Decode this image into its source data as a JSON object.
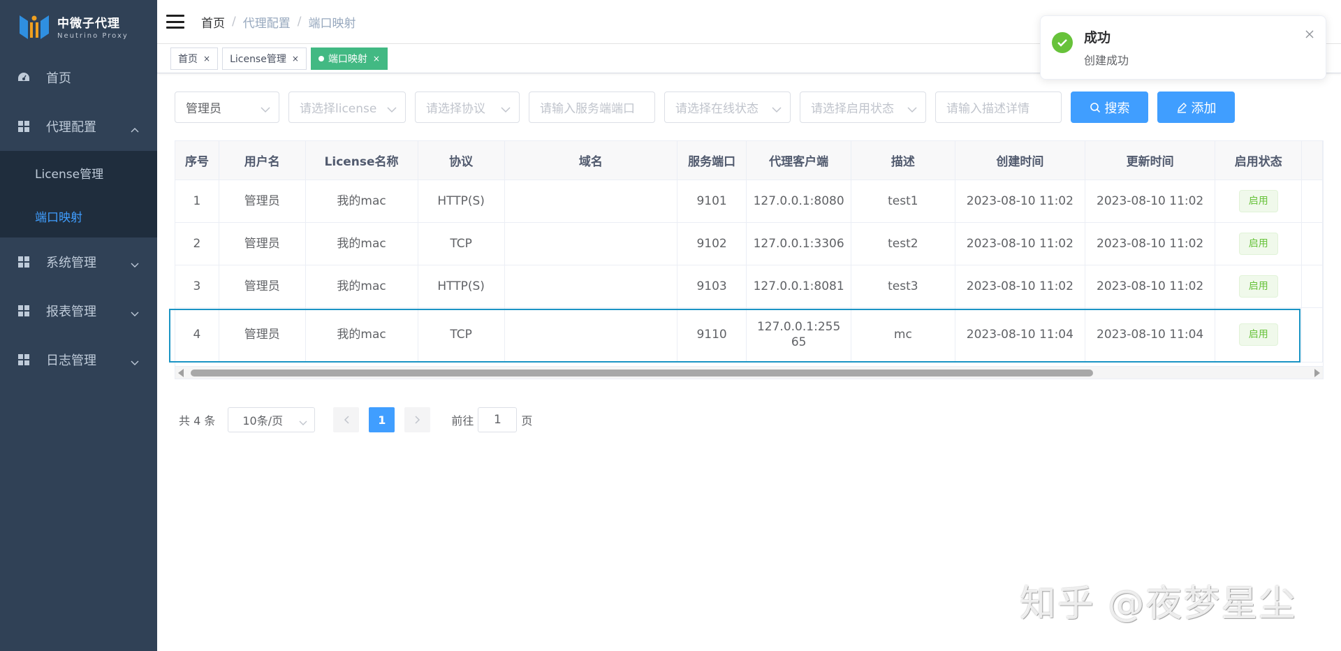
{
  "app": {
    "logo_title": "中微子代理",
    "logo_subtitle": "Neutrino Proxy"
  },
  "sidebar": {
    "items": [
      {
        "label": "首页",
        "icon": "dashboard-icon"
      },
      {
        "label": "代理配置",
        "icon": "grid-icon",
        "expanded": true,
        "children": [
          {
            "label": "License管理",
            "active": false
          },
          {
            "label": "端口映射",
            "active": true
          }
        ]
      },
      {
        "label": "系统管理",
        "icon": "grid-icon"
      },
      {
        "label": "报表管理",
        "icon": "grid-icon"
      },
      {
        "label": "日志管理",
        "icon": "grid-icon"
      }
    ]
  },
  "breadcrumb": [
    "首页",
    "代理配置",
    "端口映射"
  ],
  "tags": [
    {
      "label": "首页",
      "close": "×"
    },
    {
      "label": "License管理",
      "close": "×"
    },
    {
      "label": "端口映射",
      "close": "×",
      "active": true
    }
  ],
  "filters": {
    "user": "管理员",
    "license_placeholder": "请选择license",
    "protocol_placeholder": "请选择协议",
    "server_port_placeholder": "请输入服务端端口",
    "online_status_placeholder": "请选择在线状态",
    "enable_status_placeholder": "请选择启用状态",
    "description_placeholder": "请输入描述详情",
    "search_label": "搜索",
    "add_label": "添加"
  },
  "table": {
    "columns": [
      "序号",
      "用户名",
      "License名称",
      "协议",
      "域名",
      "服务端口",
      "代理客户端",
      "描述",
      "创建时间",
      "更新时间",
      "启用状态"
    ],
    "rows": [
      {
        "index": "1",
        "user": "管理员",
        "license": "我的mac",
        "protocol": "HTTP(S)",
        "domain": "",
        "port": "9101",
        "client": "127.0.0.1:8080",
        "desc": "test1",
        "created": "2023-08-10 11:02",
        "updated": "2023-08-10 11:02",
        "status": "启用"
      },
      {
        "index": "2",
        "user": "管理员",
        "license": "我的mac",
        "protocol": "TCP",
        "domain": "",
        "port": "9102",
        "client": "127.0.0.1:3306",
        "desc": "test2",
        "created": "2023-08-10 11:02",
        "updated": "2023-08-10 11:02",
        "status": "启用"
      },
      {
        "index": "3",
        "user": "管理员",
        "license": "我的mac",
        "protocol": "HTTP(S)",
        "domain": "",
        "port": "9103",
        "client": "127.0.0.1:8081",
        "desc": "test3",
        "created": "2023-08-10 11:02",
        "updated": "2023-08-10 11:02",
        "status": "启用"
      },
      {
        "index": "4",
        "user": "管理员",
        "license": "我的mac",
        "protocol": "TCP",
        "domain": "",
        "port": "9110",
        "client": "127.0.0.1:25565",
        "desc": "mc",
        "created": "2023-08-10 11:04",
        "updated": "2023-08-10 11:04",
        "status": "启用"
      }
    ]
  },
  "pagination": {
    "total": "共 4 条",
    "page_size": "10条/页",
    "current_page": "1",
    "goto_prefix": "前往",
    "goto_value": "1",
    "goto_suffix": "页"
  },
  "notification": {
    "title": "成功",
    "message": "创建成功",
    "type": "success"
  },
  "watermark": "知乎 @夜梦星尘",
  "colors": {
    "sidebar_bg": "#304156",
    "submenu_bg": "#1f2d3d",
    "primary": "#409eff",
    "tag_active": "#42b983",
    "success": "#67c23a"
  }
}
